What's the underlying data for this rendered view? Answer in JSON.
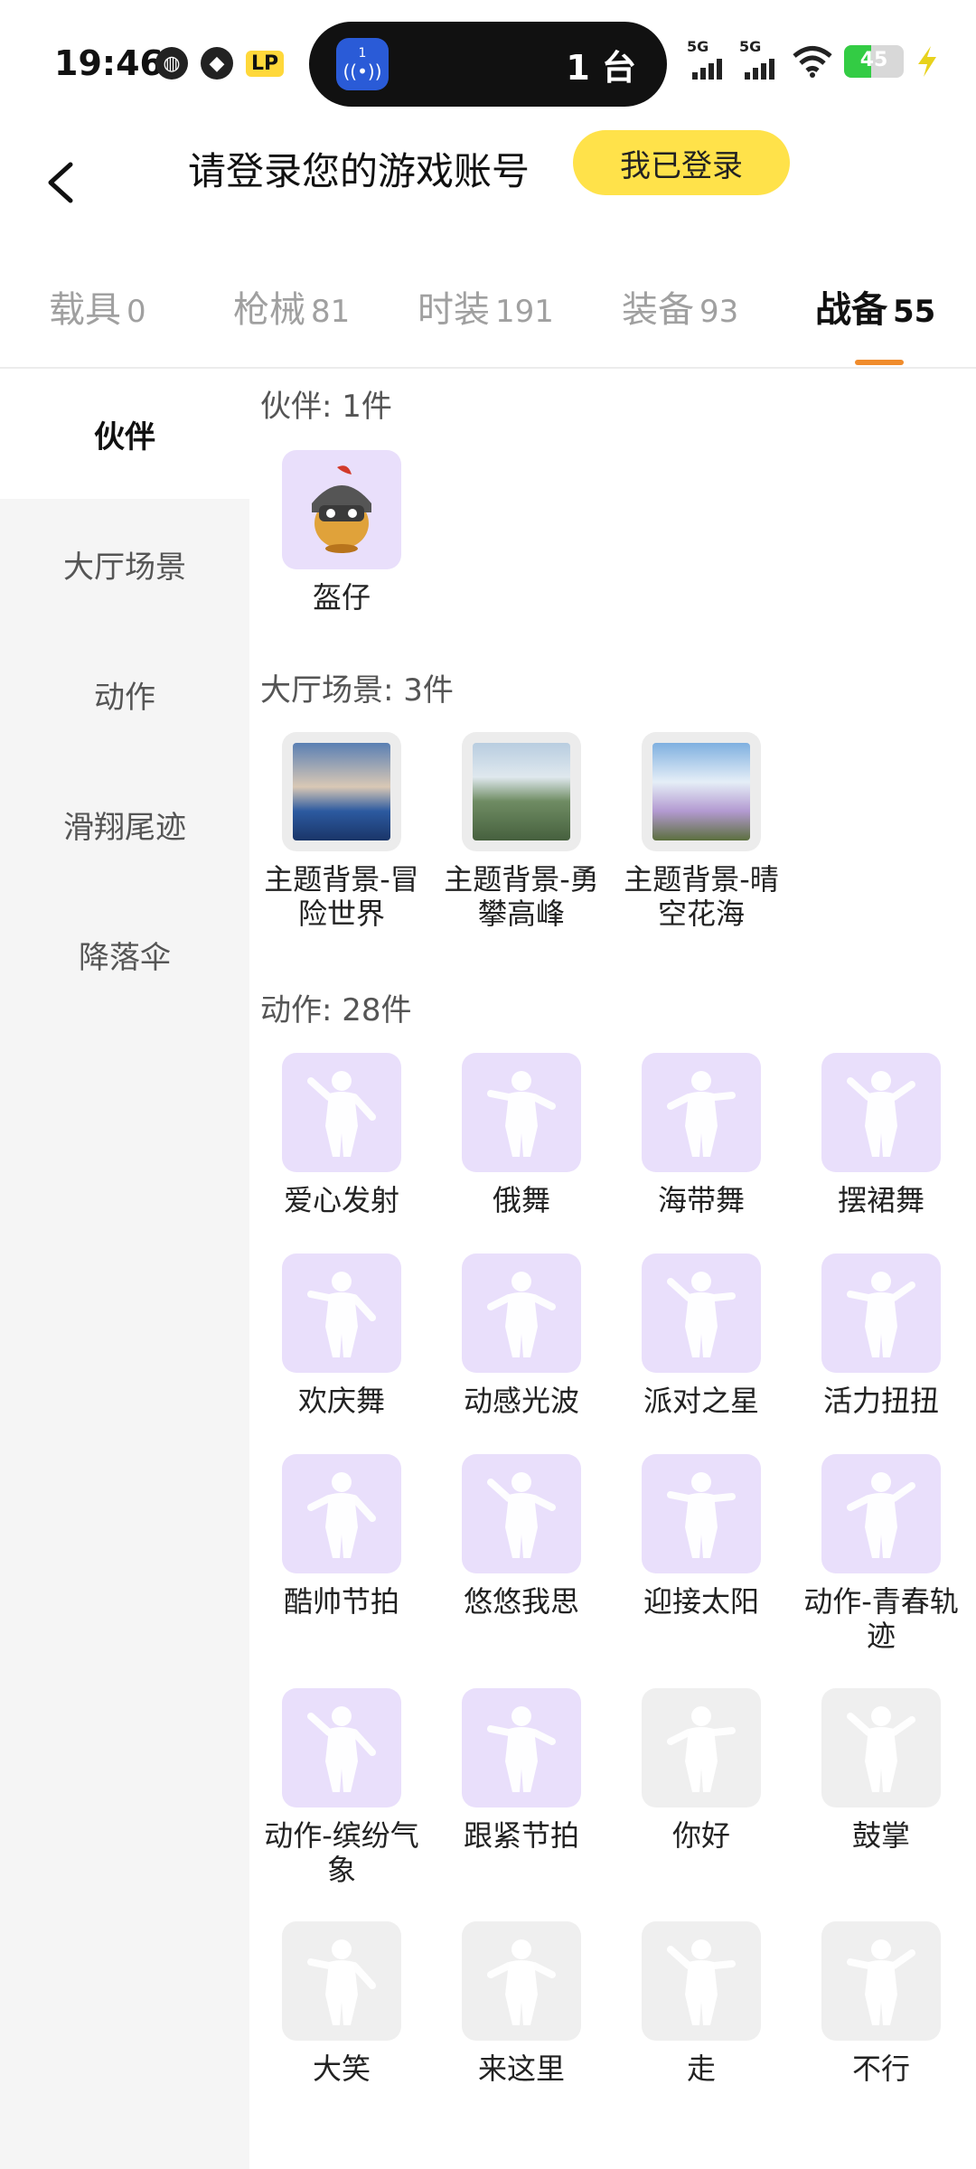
{
  "status_bar": {
    "time": "19:46",
    "island_count": "1 台",
    "battery_level": "45",
    "net_labels": [
      "5G",
      "5G"
    ],
    "badge": "LP"
  },
  "header": {
    "title": "请登录您的游戏账号",
    "login_button": "我已登录"
  },
  "tabs": [
    {
      "name": "载具",
      "count": "0"
    },
    {
      "name": "枪械",
      "count": "81"
    },
    {
      "name": "时装",
      "count": "191"
    },
    {
      "name": "装备",
      "count": "93"
    },
    {
      "name": "战备",
      "count": "55"
    }
  ],
  "sidebar": {
    "items": [
      "伙伴",
      "大厅场景",
      "动作",
      "滑翔尾迹",
      "降落伞"
    ],
    "active_index": 0
  },
  "sections": {
    "partner": {
      "title": "伙伴: 1件",
      "items": [
        "盔仔"
      ]
    },
    "scene": {
      "title": "大厅场景: 3件",
      "items": [
        "主题背景-冒险世界",
        "主题背景-勇攀高峰",
        "主题背景-晴空花海"
      ]
    },
    "action": {
      "title": "动作: 28件",
      "items": [
        "爱心发射",
        "俄舞",
        "海带舞",
        "摆裙舞",
        "欢庆舞",
        "动感光波",
        "派对之星",
        "活力扭扭",
        "酷帅节拍",
        "悠悠我思",
        "迎接太阳",
        "动作-青春轨迹",
        "动作-缤纷气象",
        "跟紧节拍",
        "你好",
        "鼓掌",
        "大笑",
        "来这里",
        "走",
        "不行"
      ]
    }
  },
  "colors": {
    "accent": "#f08c2c",
    "login_button": "#ffe24a",
    "owned_tile": "#e9dffb",
    "unowned_tile": "#efefef"
  }
}
